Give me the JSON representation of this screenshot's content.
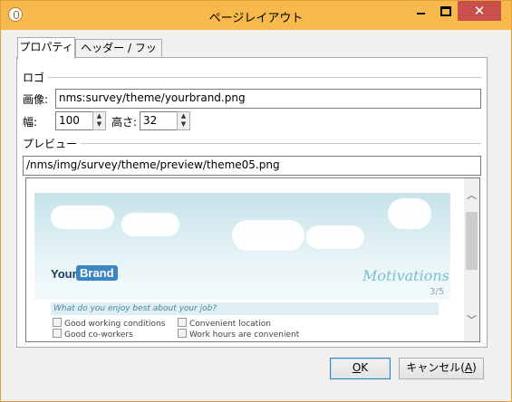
{
  "window": {
    "title": "ページレイアウト",
    "close_glyph": "✕"
  },
  "tabs": [
    {
      "label": "プロパティ",
      "active": true
    },
    {
      "label": "ヘッダー / フッター",
      "active": false
    }
  ],
  "logo_section": {
    "label": "ロゴ",
    "image_label": "画像:",
    "image_value": "nms:survey/theme/yourbrand.png",
    "width_label": "幅:",
    "width_value": "100",
    "height_label": "高さ:",
    "height_value": "32"
  },
  "preview_section": {
    "label": "プレビュー",
    "path_value": "/nms/img/survey/theme/preview/theme05.png"
  },
  "preview_image": {
    "logo_your": "Your",
    "logo_brand": "Brand",
    "heading": "Motivations",
    "pager": "3/5",
    "question": "What do you enjoy best about your job?",
    "options": [
      "Good working conditions",
      "Convenient location",
      "Good co-workers",
      "Work hours are convenient"
    ]
  },
  "buttons": {
    "ok_main": "",
    "ok_mnemonic": "O",
    "ok_rest": "K",
    "cancel_main": "キャンセル(",
    "cancel_mnemonic": "A",
    "cancel_rest": ")"
  }
}
